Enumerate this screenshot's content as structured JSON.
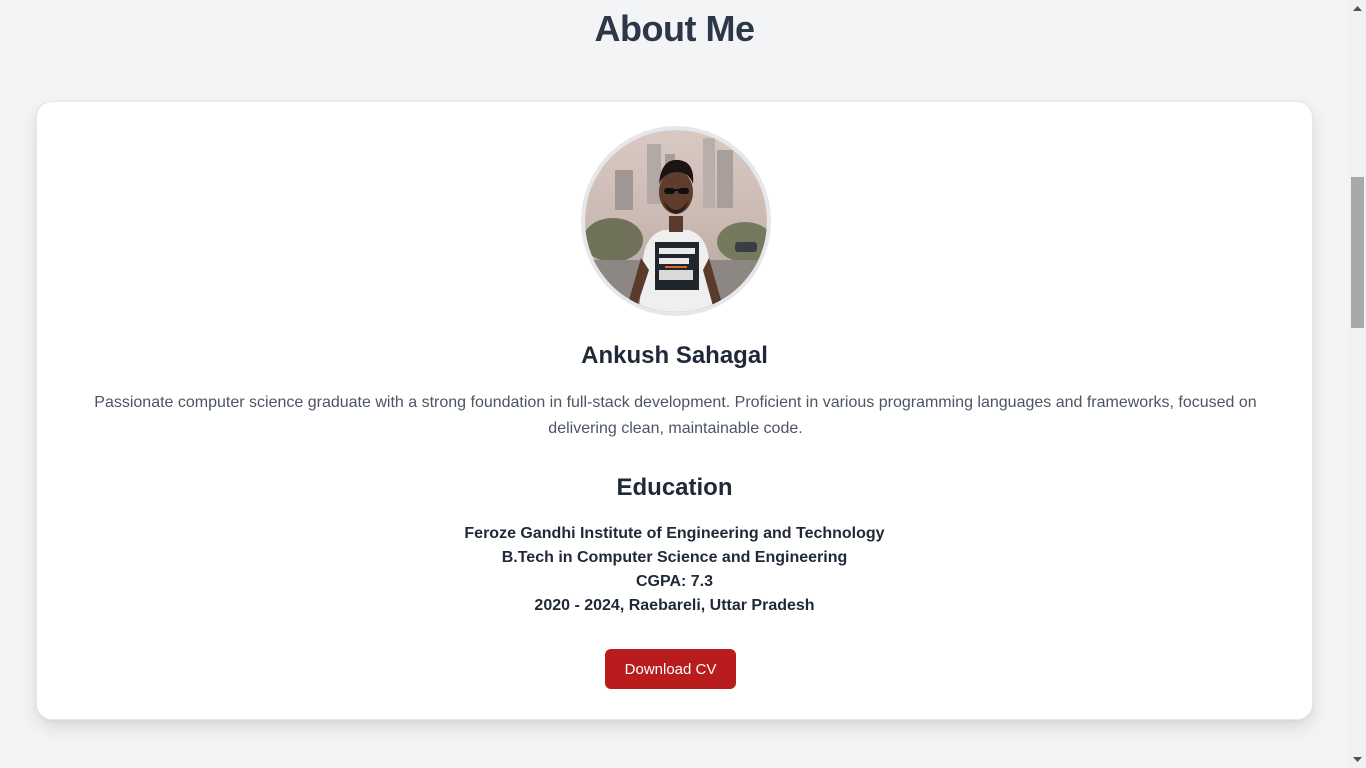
{
  "about": {
    "title": "About Me",
    "name": "Ankush Sahagal",
    "bio": "Passionate computer science graduate with a strong foundation in full-stack development. Proficient in various programming languages and frameworks, focused on delivering clean, maintainable code."
  },
  "education": {
    "title": "Education",
    "institution": "Feroze Gandhi Institute of Engineering and Technology",
    "degree": "B.Tech in Computer Science and Engineering",
    "cgpa": "CGPA: 7.3",
    "period": "2020 - 2024, Raebareli, Uttar Pradesh"
  },
  "actions": {
    "download_label": "Download CV"
  },
  "colors": {
    "accent": "#b91c1c",
    "background": "#f3f4f6",
    "card": "#ffffff"
  },
  "icons": {
    "scroll_up": "scroll-up-arrow-icon",
    "scroll_down": "scroll-down-arrow-icon"
  }
}
